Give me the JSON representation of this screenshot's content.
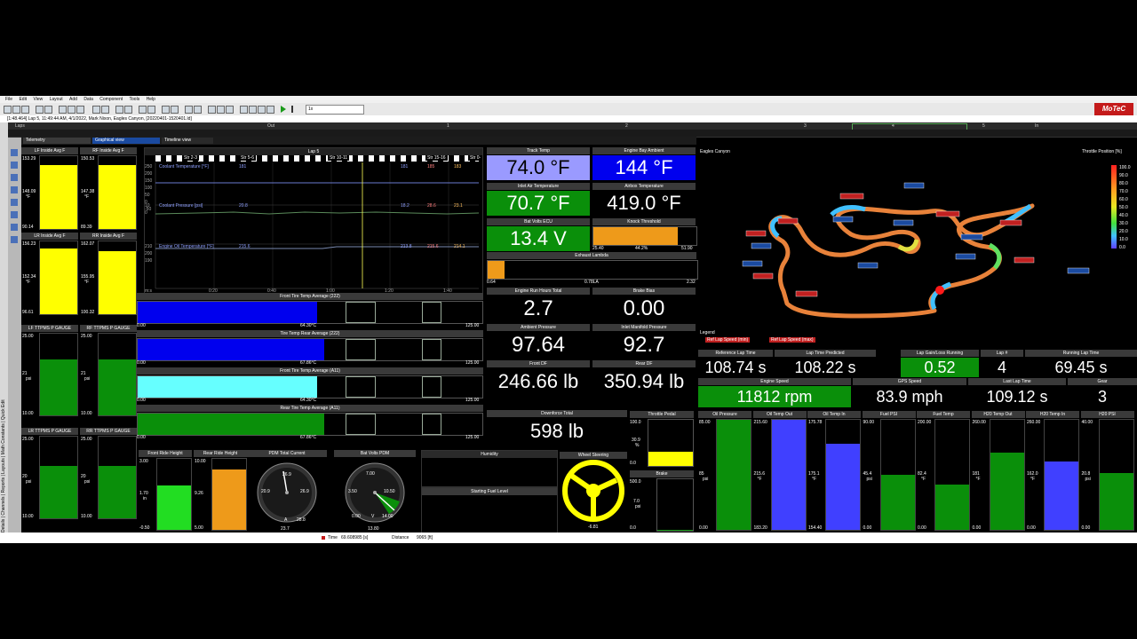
{
  "menu": [
    "File",
    "Edit",
    "View",
    "Layout",
    "Add",
    "Data",
    "Component",
    "Tools",
    "Help"
  ],
  "brand": "MoTeC",
  "toolbar": {
    "zoom_value": "1x"
  },
  "title_line": "[1:48.464] Lap 5, 11:49:44 AM, 4/1/2022, Mark Nixon, Eagles Canyon, [20220401-1520401.ld]",
  "laps": {
    "label": "Laps",
    "out": "Out",
    "markers": [
      "1",
      "2",
      "3",
      "4",
      "5",
      "In"
    ]
  },
  "left_tabs": [
    "Details",
    "Channels",
    "Reports",
    "Layouts",
    "Math Constants",
    "Quick Edit"
  ],
  "subtabs": {
    "telemetry": "Telemetry",
    "graphical": "Graphical view",
    "timeline": "Timeline view"
  },
  "tire_inside": [
    {
      "label": "LF Inside Avg F",
      "top": "153.29",
      "value": "148.09",
      "unit": "°F",
      "bottom": "90.14",
      "fill": 0.88
    },
    {
      "label": "RF Inside Avg F",
      "top": "150.53",
      "value": "147.38",
      "unit": "°F",
      "bottom": "89.39",
      "fill": 0.88
    },
    {
      "label": "LR Inside Avg F",
      "top": "156.23",
      "value": "152.34",
      "unit": "°F",
      "bottom": "96.61",
      "fill": 0.9
    },
    {
      "label": "RR Inside Avg F",
      "top": "162.07",
      "value": "155.95",
      "unit": "°F",
      "bottom": "100.32",
      "fill": 0.86
    }
  ],
  "tpms": [
    {
      "label": "LF TTPMS P GAUGE",
      "top": "25.00",
      "value": "21",
      "unit": "psi",
      "bottom": "10.00",
      "fill": 0.68
    },
    {
      "label": "RF TTPMS P GAUGE",
      "top": "25.00",
      "value": "21",
      "unit": "psi",
      "bottom": "10.00",
      "fill": 0.68
    },
    {
      "label": "LR TTPMS P GAUGE",
      "top": "25.00",
      "value": "20",
      "unit": "psi",
      "bottom": "10.00",
      "fill": 0.64
    },
    {
      "label": "RR TTPMS P GAUGE",
      "top": "25.00",
      "value": "20",
      "unit": "psi",
      "bottom": "10.00",
      "fill": 0.64
    }
  ],
  "graph": {
    "lap": "Lap 5",
    "sectors": [
      "Str 2-3",
      "Str 5-6",
      "Str 10-11",
      "Str 15-16",
      "Str 0-"
    ],
    "traces": [
      {
        "name": "Coolant Temperature [°F]",
        "value": "181",
        "m1": "181",
        "m2": "185",
        "m3": "183",
        "yticks": [
          "250",
          "200",
          "150",
          "100",
          "50",
          "0",
          "-50"
        ]
      },
      {
        "name": "Coolant Pressure [psi]",
        "value": "20.8",
        "m1": "18.2",
        "m2": "28.6",
        "m3": "23.1",
        "yticks": [
          "10",
          "0"
        ]
      },
      {
        "name": "Engine Oil Temperature [°F]",
        "value": "215.6",
        "m1": "213.8",
        "m2": "215.6",
        "m3": "214.1",
        "yticks": [
          "210",
          "200",
          "190"
        ]
      }
    ],
    "xunit": "m:s",
    "xticks": [
      "0:20",
      "0:40",
      "1:00",
      "1:20",
      "1:40"
    ]
  },
  "hbars": [
    {
      "label": "Front Tire Temp Average (222)",
      "min": "0.00",
      "mid": "64.30°C",
      "max": "125.00",
      "fill": 0.52,
      "color": "#0000ee"
    },
    {
      "label": "Tire Temp Rear Average (222)",
      "min": "0.00",
      "mid": "67.86°C",
      "max": "125.00",
      "fill": 0.54,
      "color": "#0000ee"
    },
    {
      "label": "Front Tire Temp Average (A11)",
      "min": "0.00",
      "mid": "64.30°C",
      "max": "125.00",
      "fill": 0.52,
      "color": "#66ffff"
    },
    {
      "label": "Rear Tire Temp Average (A11)",
      "min": "0.00",
      "mid": "67.86°C",
      "max": "125.00",
      "fill": 0.54,
      "color": "#0a8f0a"
    }
  ],
  "center_values": [
    {
      "label": "Track Temp",
      "value": "74.0 °F",
      "bg": "#9a9aff",
      "fg": "#000"
    },
    {
      "label": "Engine Bay Ambient",
      "value": "144 °F",
      "bg": "#0000ee",
      "fg": "#fff"
    },
    {
      "label": "Inlet Air Temperature",
      "value": "70.7 °F",
      "bg": "#0a8f0a",
      "fg": "#fff"
    },
    {
      "label": "Airbox Temperature",
      "value": "419.0 °F",
      "bg": "#000",
      "fg": "#fff"
    },
    {
      "label": "Bat Volts ECU",
      "value": "13.4 V",
      "bg": "#0a8f0a",
      "fg": "#fff"
    }
  ],
  "knock": {
    "label": "Knock Threshold",
    "min": "25.40",
    "mid": "44.2%",
    "max": "51.90",
    "fill": 0.82
  },
  "lambda": {
    "label": "Exhaust Lambda",
    "min": "0.64",
    "mid": "0.78LA",
    "max": "2.32",
    "fill": 0.08
  },
  "center_nums": [
    {
      "label": "Engine Run Hours Total",
      "value": "2.7"
    },
    {
      "label": "Brake Bias",
      "value": "0.00"
    },
    {
      "label": "Ambient Pressure",
      "value": "97.64"
    },
    {
      "label": "Inlet Manifold Pressure",
      "value": "92.7"
    },
    {
      "label": "Front DF",
      "value": "246.66 lb"
    },
    {
      "label": "Rear DF",
      "value": "350.94 lb"
    },
    {
      "label": "Downforce Total",
      "value": "598 lb"
    }
  ],
  "throttle": {
    "label": "Throttle Pedal",
    "top": "100.0",
    "value": "30.9",
    "unit": "%",
    "bottom": "0.0",
    "fill": 0.31
  },
  "brake": {
    "label": "Brake",
    "top": "500.0",
    "value": "7.0",
    "unit": "psi",
    "bottom": "0.0",
    "fill": 0.01
  },
  "map": {
    "title": "Eagles Canyon",
    "legend_title": "Legend",
    "legend_items": [
      "Ref Lap Speed (min)",
      "Ref Lap Speed (max)"
    ],
    "scale_title": "Throttle Position [%]",
    "scale": [
      "100.0",
      "90.0",
      "80.0",
      "70.0",
      "60.0",
      "50.0",
      "40.0",
      "30.0",
      "20.0",
      "10.0",
      "0.0"
    ]
  },
  "lap_stats": [
    {
      "label": "Reference Lap Time",
      "value": "108.74 s",
      "bg": "#000"
    },
    {
      "label": "Lap Time Predicted",
      "value": "108.22 s",
      "bg": "#000"
    },
    {
      "label": "Lap Gain/Loss Running",
      "value": "0.52",
      "bg": "#0a8f0a"
    },
    {
      "label": "Lap #",
      "value": "4",
      "bg": "#000"
    },
    {
      "label": "Running Lap Time",
      "value": "69.45 s",
      "bg": "#000"
    }
  ],
  "lap_stats2": [
    {
      "label": "Engine Speed",
      "value": "11812 rpm",
      "bg": "#0a8f0a"
    },
    {
      "label": "GPS Speed",
      "value": "83.9 mph",
      "bg": "#000"
    },
    {
      "label": "Last Lap Time",
      "value": "109.12 s",
      "bg": "#000"
    },
    {
      "label": "Gear",
      "value": "3",
      "bg": "#000"
    }
  ],
  "right_gauges": [
    {
      "label": "Oil Pressure",
      "top": "85.00",
      "value": "85",
      "unit": "psi",
      "bottom": "0.00",
      "fill": 1.0,
      "color": "#0a8f0a"
    },
    {
      "label": "Oil Temp Out",
      "top": "215.60",
      "value": "215.6",
      "unit": "°F",
      "bottom": "183.20",
      "fill": 1.0,
      "color": "#4040ff"
    },
    {
      "label": "Oil Temp In",
      "top": "175.78",
      "value": "175.1",
      "unit": "°F",
      "bottom": "154.40",
      "fill": 0.78,
      "color": "#4040ff"
    },
    {
      "label": "Fuel PSI",
      "top": "90.00",
      "value": "45.4",
      "unit": "psi",
      "bottom": "0.00",
      "fill": 0.5,
      "color": "#0a8f0a"
    },
    {
      "label": "Fuel Temp",
      "top": "200.00",
      "value": "82.4",
      "unit": "°F",
      "bottom": "0.00",
      "fill": 0.41,
      "color": "#0a8f0a"
    },
    {
      "label": "H20 Temp Out",
      "top": "260.00",
      "value": "181",
      "unit": "°F",
      "bottom": "0.00",
      "fill": 0.7,
      "color": "#0a8f0a"
    },
    {
      "label": "H20 Temp In",
      "top": "260.00",
      "value": "162.0",
      "unit": "°F",
      "bottom": "0.00",
      "fill": 0.62,
      "color": "#4040ff"
    },
    {
      "label": "H20 PSI",
      "top": "40.00",
      "value": "20.8",
      "unit": "psi",
      "bottom": "0.00",
      "fill": 0.52,
      "color": "#0a8f0a"
    }
  ],
  "ride": [
    {
      "label": "Front Ride Height",
      "top": "3.00",
      "value": "1.70",
      "unit": "in",
      "bottom": "-0.50",
      "fill": 0.63,
      "color": "#22dd22"
    },
    {
      "label": "Rear Ride Height",
      "top": "10.00",
      "value": "9.26",
      "unit": "",
      "bottom": "5.00",
      "fill": 0.85,
      "color": "#ee9a1a"
    }
  ],
  "pdm_current": {
    "label": "PDM Total Current",
    "ticks": [
      "20.9",
      "26.9",
      "23.7",
      "26.9",
      "28.8"
    ],
    "unit": "A",
    "bottom": "23.7"
  },
  "bat_pdm": {
    "label": "Bat Volts PDM",
    "ticks": [
      "7.00",
      "3.50",
      "10.50",
      "0.00",
      "14.00"
    ],
    "unit": "V",
    "bottom": "13.80"
  },
  "humidity": {
    "label": "Humidity"
  },
  "fuel_level": {
    "label": "Starting Fuel Level"
  },
  "steering": {
    "label": "Wheel Steering",
    "value": "-6.81"
  },
  "status": {
    "time_label": "Time",
    "time_value": "69.608985 [s]",
    "dist_label": "Distance",
    "dist_value": "9065 [ft]"
  }
}
